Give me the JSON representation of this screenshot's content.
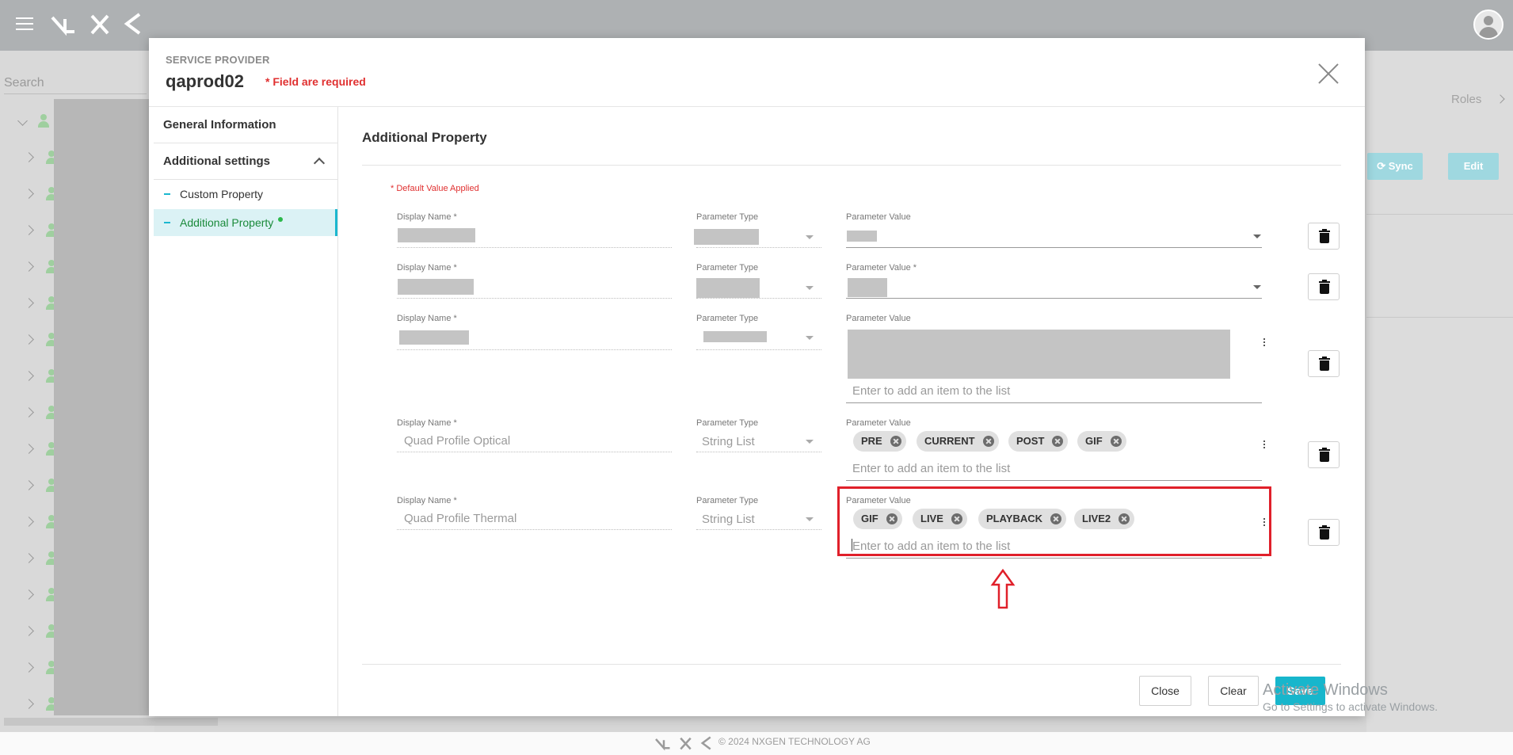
{
  "app": {
    "search_placeholder": "Search",
    "roles_label": "Roles",
    "sync_label": "Sync",
    "edit_label": "Edit",
    "footer_text": "© 2024 NXGEN TECHNOLOGY AG",
    "windows_activation_title": "Activate Windows",
    "windows_activation_sub": "Go to Settings to activate Windows."
  },
  "modal": {
    "eyebrow": "SERVICE PROVIDER",
    "title": "qaprod02",
    "required_note": "* Field are required",
    "sidebar": {
      "general": "General Information",
      "additional": "Additional settings",
      "custom_property": "Custom Property",
      "additional_property": "Additional Property"
    },
    "content": {
      "title": "Additional Property",
      "default_note": "* Default Value Applied",
      "rows": [
        {
          "display_label": "Display Name *",
          "type_label": "Parameter Type",
          "value_label": "Parameter Value",
          "display_value": "",
          "type_value": "",
          "add_placeholder": ""
        },
        {
          "display_label": "Display Name *",
          "type_label": "Parameter Type",
          "value_label": "Parameter Value *",
          "display_value": "",
          "type_value": "",
          "add_placeholder": ""
        },
        {
          "display_label": "Display Name *",
          "type_label": "Parameter Type",
          "value_label": "Parameter Value",
          "display_value": "",
          "type_value": "",
          "add_placeholder": "Enter to add an item to the list"
        },
        {
          "display_label": "Display Name *",
          "type_label": "Parameter Type",
          "value_label": "Parameter Value",
          "display_value": "Quad Profile Optical",
          "type_value": "String List",
          "add_placeholder": "Enter to add an item to the list",
          "chips": [
            "PRE",
            "CURRENT",
            "POST",
            "GIF"
          ]
        },
        {
          "display_label": "Display Name *",
          "type_label": "Parameter Type",
          "value_label": "Parameter Value",
          "display_value": "Quad Profile Thermal",
          "type_value": "String List",
          "add_placeholder": "Enter to add an item to the list",
          "chips": [
            "GIF",
            "LIVE",
            "PLAYBACK",
            "LIVE2"
          ]
        }
      ]
    },
    "buttons": {
      "close": "Close",
      "clear": "Clear",
      "save": "Save"
    }
  },
  "colors": {
    "accent": "#17b6cc",
    "required": "#e03030",
    "highlight": "#e0202a"
  }
}
